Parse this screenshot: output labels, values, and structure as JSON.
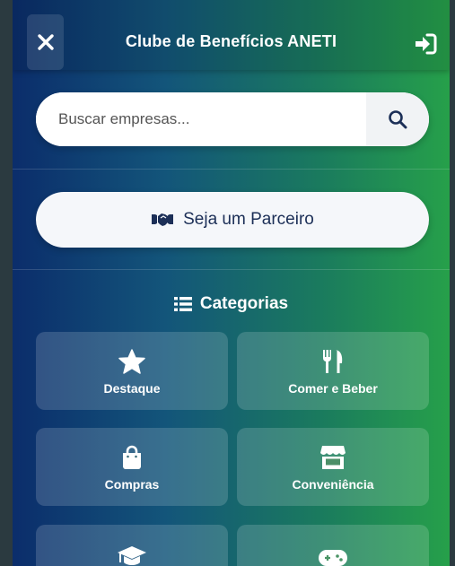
{
  "header": {
    "title": "Clube de Benefícios ANETI",
    "close_icon": "close-icon",
    "login_icon": "sign-in-icon"
  },
  "search": {
    "placeholder": "Buscar empresas...",
    "value": "",
    "icon": "search-icon"
  },
  "partner": {
    "label": "Seja um Parceiro",
    "icon": "handshake-icon"
  },
  "categories": {
    "title": "Categorias",
    "icon": "list-icon",
    "items": [
      {
        "label": "Destaque",
        "icon": "star-icon"
      },
      {
        "label": "Comer e Beber",
        "icon": "utensils-icon"
      },
      {
        "label": "Compras",
        "icon": "shopping-bag-icon"
      },
      {
        "label": "Conveniência",
        "icon": "store-icon"
      },
      {
        "label": "",
        "icon": "graduation-cap-icon"
      },
      {
        "label": "",
        "icon": "gamepad-icon"
      }
    ]
  },
  "colors": {
    "gradient_start": "#0b2d6b",
    "gradient_end": "#26a04a",
    "text_dark": "#1c2f57"
  }
}
